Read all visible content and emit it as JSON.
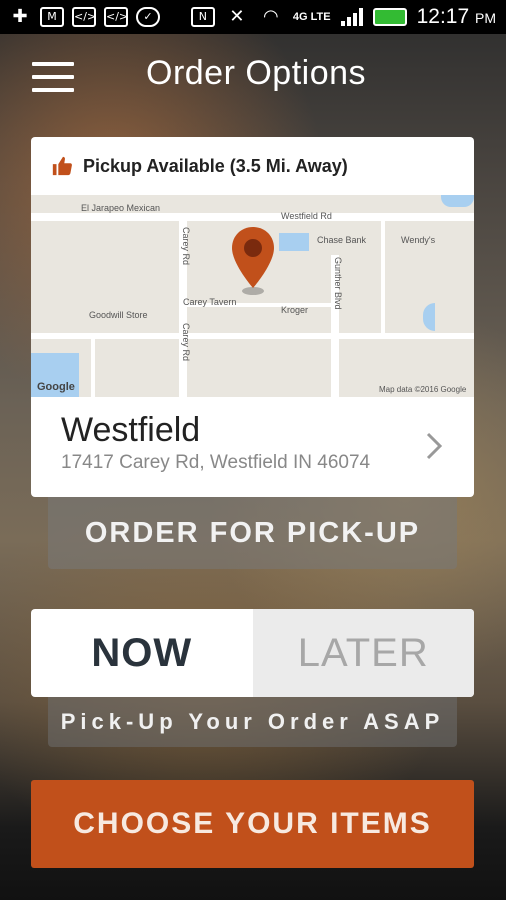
{
  "status_bar": {
    "network": "4G LTE",
    "time": "12:17",
    "ampm": "PM"
  },
  "header": {
    "title": "Order Options"
  },
  "store_card": {
    "availability": "Pickup Available (3.5 Mi. Away)",
    "map_labels": {
      "el_jarapeo": "El Jarapeo Mexican",
      "westfield_rd": "Westfield Rd",
      "chase_bank": "Chase Bank",
      "wendys": "Wendy's",
      "carey_rd_top": "Carey Rd",
      "carey_rd_bottom": "Carey Rd",
      "gunther_blvd": "Gunther Blvd",
      "goodwill": "Goodwill Store",
      "carey_tavern": "Carey Tavern",
      "kroger": "Kroger",
      "google": "Google",
      "map_data": "Map data ©2016 Google"
    },
    "name": "Westfield",
    "address": "17417 Carey Rd, Westfield IN 46074"
  },
  "pickup_label": "ORDER FOR PICK-UP",
  "time_toggle": {
    "now": "NOW",
    "later": "LATER",
    "selected": "now"
  },
  "asap_label": "Pick-Up Your Order ASAP",
  "choose_label": "CHOOSE YOUR ITEMS",
  "colors": {
    "accent": "#c1501b",
    "pin": "#c1501b"
  }
}
